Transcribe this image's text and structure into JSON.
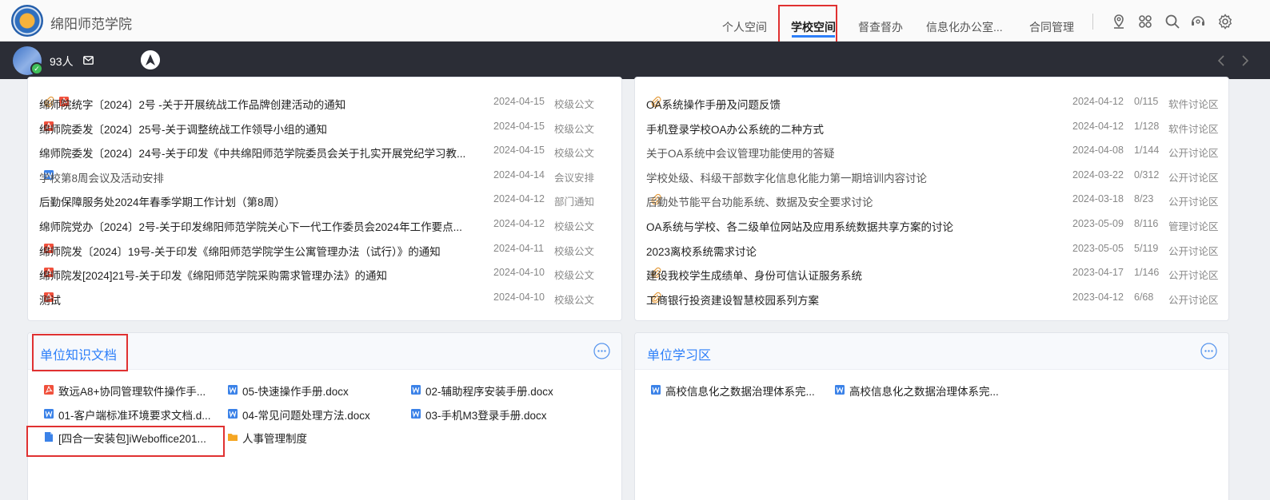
{
  "header": {
    "school_name": "绵阳师范学院",
    "nav": [
      "个人空间",
      "学校空间",
      "督查督办",
      "信息化办公室...",
      "合同管理"
    ],
    "active_nav": 1,
    "tools": [
      "location-icon",
      "apps-icon",
      "search-icon",
      "support-icon",
      "gear-icon"
    ]
  },
  "statusbar": {
    "count": "93人"
  },
  "notices": [
    {
      "title": "绵师院统字〔2024〕2号 -关于开展统战工作品牌创建活动的通知",
      "icons": [
        "clip",
        "pdf"
      ],
      "date": "2024-04-15",
      "category": "校级公文",
      "muted": false
    },
    {
      "title": "绵师院委发〔2024〕25号-关于调整统战工作领导小组的通知",
      "icons": [
        "pdf"
      ],
      "date": "2024-04-15",
      "category": "校级公文",
      "muted": false
    },
    {
      "title": "绵师院委发〔2024〕24号-关于印发《中共绵阳师范学院委员会关于扎实开展党纪学习教...",
      "icons": [],
      "date": "2024-04-15",
      "category": "校级公文",
      "muted": false
    },
    {
      "title": "学校第8周会议及活动安排",
      "icons": [
        "word"
      ],
      "date": "2024-04-14",
      "category": "会议安排",
      "muted": true
    },
    {
      "title": "后勤保障服务处2024年春季学期工作计划（第8周）",
      "icons": [],
      "date": "2024-04-12",
      "category": "部门通知",
      "muted": false
    },
    {
      "title": "绵师院党办〔2024〕2号-关于印发绵阳师范学院关心下一代工作委员会2024年工作要点...",
      "icons": [],
      "date": "2024-04-12",
      "category": "校级公文",
      "muted": false
    },
    {
      "title": "绵师院发〔2024〕19号-关于印发《绵阳师范学院学生公寓管理办法（试行）》的通知",
      "icons": [
        "pdf"
      ],
      "date": "2024-04-11",
      "category": "校级公文",
      "muted": false
    },
    {
      "title": "绵师院发[2024]21号-关于印发《绵阳师范学院采购需求管理办法》的通知",
      "icons": [
        "pdf"
      ],
      "date": "2024-04-10",
      "category": "校级公文",
      "muted": false
    },
    {
      "title": "测试",
      "icons": [
        "pdf"
      ],
      "date": "2024-04-10",
      "category": "校级公文",
      "muted": false
    }
  ],
  "discussions": [
    {
      "title": "OA系统操作手册及问题反馈",
      "icons": [
        "clip"
      ],
      "date": "2024-04-12",
      "count": "0/115",
      "category": "软件讨论区",
      "muted": false
    },
    {
      "title": "手机登录学校OA办公系统的二种方式",
      "icons": [],
      "date": "2024-04-12",
      "count": "1/128",
      "category": "软件讨论区",
      "muted": false
    },
    {
      "title": "关于OA系统中会议管理功能使用的答疑",
      "icons": [],
      "date": "2024-04-08",
      "count": "1/144",
      "category": "公开讨论区",
      "muted": true
    },
    {
      "title": "学校处级、科级干部数字化信息化能力第一期培训内容讨论",
      "icons": [],
      "date": "2024-03-22",
      "count": "0/312",
      "category": "公开讨论区",
      "muted": true
    },
    {
      "title": "后勤处节能平台功能系统、数据及安全要求讨论",
      "icons": [
        "clip"
      ],
      "date": "2024-03-18",
      "count": "8/23",
      "category": "公开讨论区",
      "muted": true
    },
    {
      "title": "OA系统与学校、各二级单位网站及应用系统数据共享方案的讨论",
      "icons": [],
      "date": "2023-05-09",
      "count": "8/116",
      "category": "管理讨论区",
      "muted": false
    },
    {
      "title": "2023离校系统需求讨论",
      "icons": [],
      "date": "2023-05-05",
      "count": "5/119",
      "category": "公开讨论区",
      "muted": false
    },
    {
      "title": "建设我校学生成绩单、身份可信认证服务系统",
      "icons": [
        "clip"
      ],
      "date": "2023-04-17",
      "count": "1/146",
      "category": "公开讨论区",
      "muted": false
    },
    {
      "title": "工商银行投资建设智慧校园系列方案",
      "icons": [
        "clip"
      ],
      "date": "2023-04-12",
      "count": "6/68",
      "category": "公开讨论区",
      "muted": false
    }
  ],
  "knowledge": {
    "title": "单位知识文档",
    "docs": [
      {
        "name": "致远A8+协同管理软件操作手...",
        "type": "pdf"
      },
      {
        "name": "05-快速操作手册.docx",
        "type": "word"
      },
      {
        "name": "02-辅助程序安装手册.docx",
        "type": "word"
      },
      {
        "name": "01-客户端标准环境要求文档.d...",
        "type": "word"
      },
      {
        "name": "04-常见问题处理方法.docx",
        "type": "word"
      },
      {
        "name": "03-手机M3登录手册.docx",
        "type": "word"
      },
      {
        "name": "[四合一安装包]iWeboffice201...",
        "type": "file"
      },
      {
        "name": "人事管理制度",
        "type": "folder"
      }
    ]
  },
  "study": {
    "title": "单位学习区",
    "docs": [
      {
        "name": "高校信息化之数据治理体系完...",
        "type": "word"
      },
      {
        "name": "高校信息化之数据治理体系完...",
        "type": "word"
      }
    ]
  },
  "colors": {
    "accent": "#2d7ff9",
    "highlight": "#e03131",
    "darkbar": "#2b2d36"
  }
}
